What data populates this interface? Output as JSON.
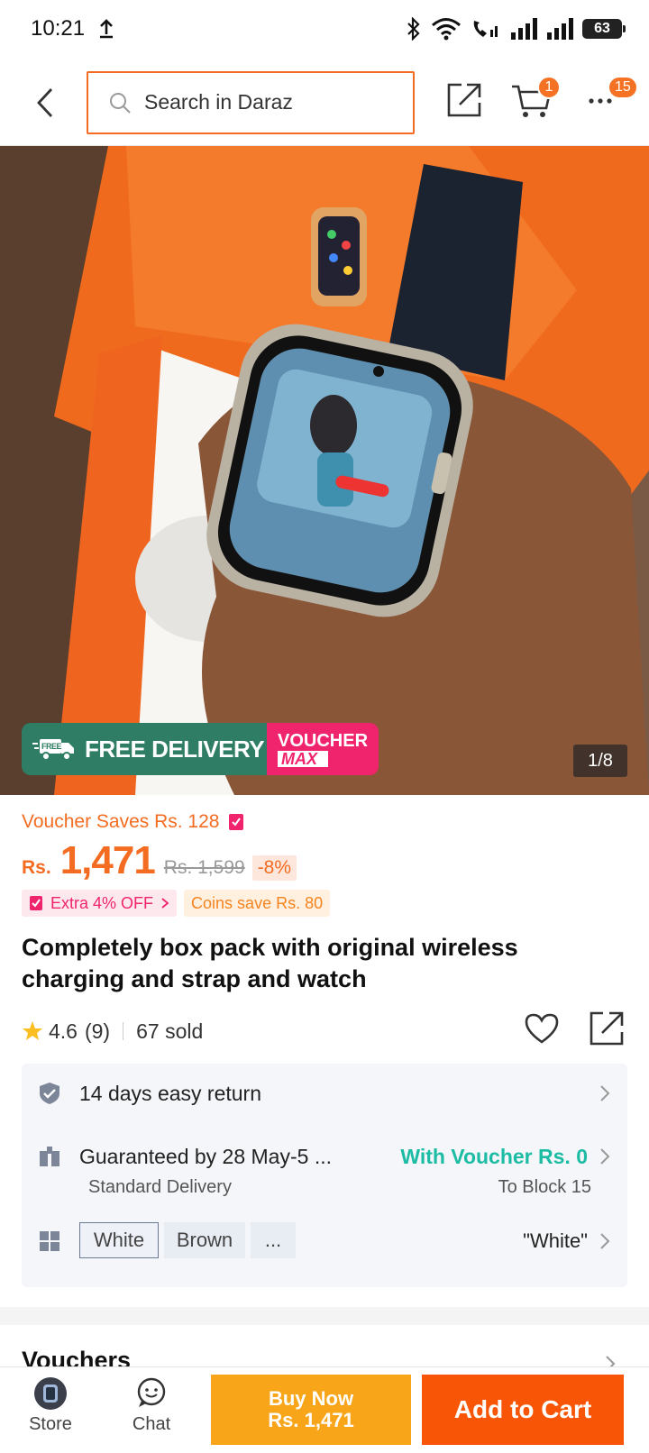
{
  "status_bar": {
    "time": "10:21",
    "battery": "63"
  },
  "header": {
    "search_placeholder": "Search in Daraz",
    "cart_badge": "1",
    "more_badge": "15"
  },
  "gallery": {
    "promo_free": "FREE DELIVERY",
    "promo_free_tag": "FREE",
    "promo_voucher_line1": "VOUCHER",
    "promo_voucher_line2": "MAX",
    "counter": "1/8"
  },
  "price": {
    "voucher_saves": "Voucher Saves Rs. 128",
    "currency": "Rs.",
    "current": "1,471",
    "original": "Rs. 1,599",
    "discount": "-8%",
    "extra_off": "Extra 4% OFF",
    "coins": "Coins save Rs. 80"
  },
  "product": {
    "title": "Completely box pack with original wireless charging and strap and watch",
    "rating": "4.6",
    "reviews": "(9)",
    "sold": "67 sold"
  },
  "info": {
    "return": "14 days easy return",
    "delivery": "Guaranteed by 28 May-5 ...",
    "delivery_voucher": "With Voucher Rs. 0",
    "delivery_type": "Standard Delivery",
    "delivery_location": "To Block 15",
    "variants": [
      "White",
      "Brown",
      "..."
    ],
    "variant_selected": "\"White\""
  },
  "sections": {
    "vouchers": "Vouchers"
  },
  "bottom": {
    "store": "Store",
    "chat": "Chat",
    "buy_now": "Buy Now",
    "buy_now_price": "Rs. 1,471",
    "add_to_cart": "Add to Cart"
  },
  "colors": {
    "accent": "#f85606",
    "buy_now": "#f9a51a",
    "voucher_teal": "#1cbca4",
    "free_delivery_green": "#2f7d64",
    "voucher_pink": "#f0246d"
  }
}
